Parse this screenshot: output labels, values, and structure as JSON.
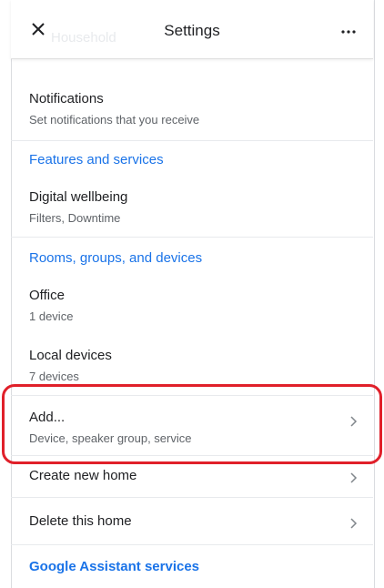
{
  "header": {
    "title": "Settings",
    "ghost_text": "Household",
    "close_icon": "close-icon",
    "more_icon": "more-horizontal-icon"
  },
  "items": {
    "notifications": {
      "title": "Notifications",
      "subtitle": "Set notifications that you receive"
    },
    "features_header": "Features and services",
    "digital_wellbeing": {
      "title": "Digital wellbeing",
      "subtitle": "Filters, Downtime"
    },
    "rooms_header": "Rooms, groups, and devices",
    "office": {
      "title": "Office",
      "subtitle": "1 device"
    },
    "local_devices": {
      "title": "Local devices",
      "subtitle": "7 devices"
    },
    "add": {
      "title": "Add...",
      "subtitle": "Device, speaker group, service"
    },
    "create_home": {
      "title": "Create new home"
    },
    "delete_home": {
      "title": "Delete this home"
    },
    "assistant_header": "Google Assistant services"
  },
  "colors": {
    "accent": "#1a73e8",
    "highlight": "#e0202a"
  }
}
